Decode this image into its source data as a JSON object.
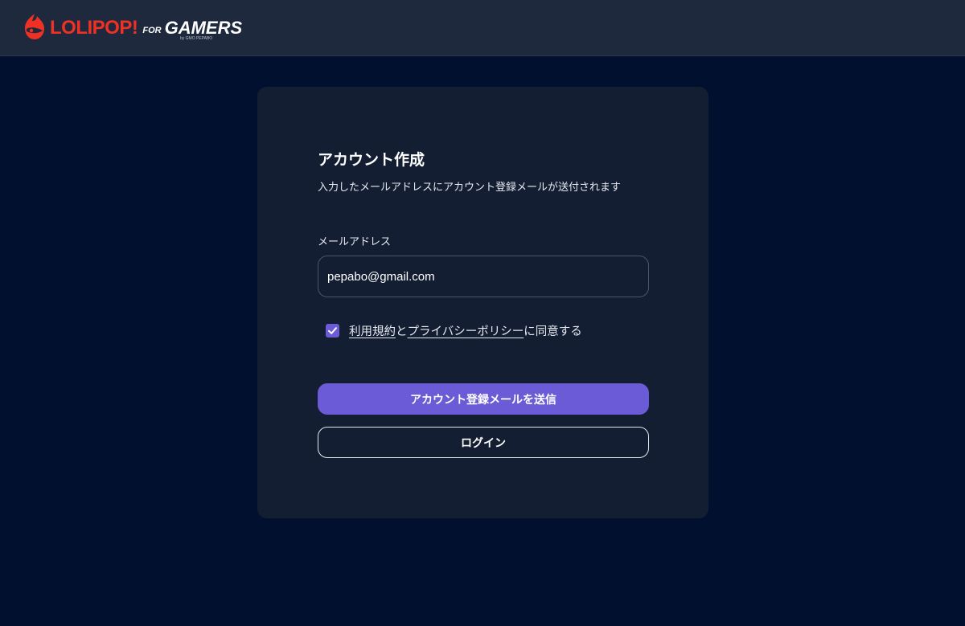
{
  "header": {
    "logo": {
      "main": "LOLIPOP!",
      "for": "FOR",
      "gamers": "GAMERS",
      "byline": "by GMO PEPABO",
      "mark_color": "#ee3124"
    }
  },
  "form": {
    "title": "アカウント作成",
    "subtitle": "入力したメールアドレスにアカウント登録メールが送付されます",
    "email": {
      "label": "メールアドレス",
      "value": "pepabo@gmail.com",
      "placeholder": ""
    },
    "agreement": {
      "checked": true,
      "terms_link": "利用規約",
      "connector": "と",
      "privacy_link": "プライバシーポリシー",
      "suffix": "に同意する"
    },
    "submit_label": "アカウント登録メールを送信",
    "login_label": "ログイン"
  },
  "colors": {
    "background": "#021030",
    "header": "#1e293d",
    "card": "#131e33",
    "accent": "#6b5bd6",
    "brand_red": "#ee3124"
  },
  "icons": {
    "logo": "lolipop-logo-icon",
    "checkbox": "checkmark-icon"
  }
}
